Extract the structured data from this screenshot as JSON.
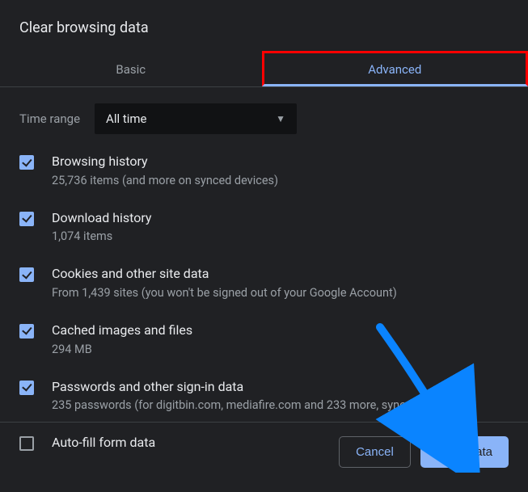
{
  "title": "Clear browsing data",
  "tabs": {
    "basic": "Basic",
    "advanced": "Advanced"
  },
  "time": {
    "label": "Time range",
    "value": "All time"
  },
  "items": [
    {
      "title": "Browsing history",
      "sub": "25,736 items (and more on synced devices)",
      "checked": true
    },
    {
      "title": "Download history",
      "sub": "1,074 items",
      "checked": true
    },
    {
      "title": "Cookies and other site data",
      "sub": "From 1,439 sites (you won't be signed out of your Google Account)",
      "checked": true
    },
    {
      "title": "Cached images and files",
      "sub": "294 MB",
      "checked": true
    },
    {
      "title": "Passwords and other sign-in data",
      "sub": "235 passwords (for digitbin.com, mediafire.com and 233 more, synced)",
      "checked": true
    },
    {
      "title": "Auto-fill form data",
      "sub": "",
      "checked": false
    }
  ],
  "buttons": {
    "cancel": "Cancel",
    "clear": "Clear data"
  }
}
